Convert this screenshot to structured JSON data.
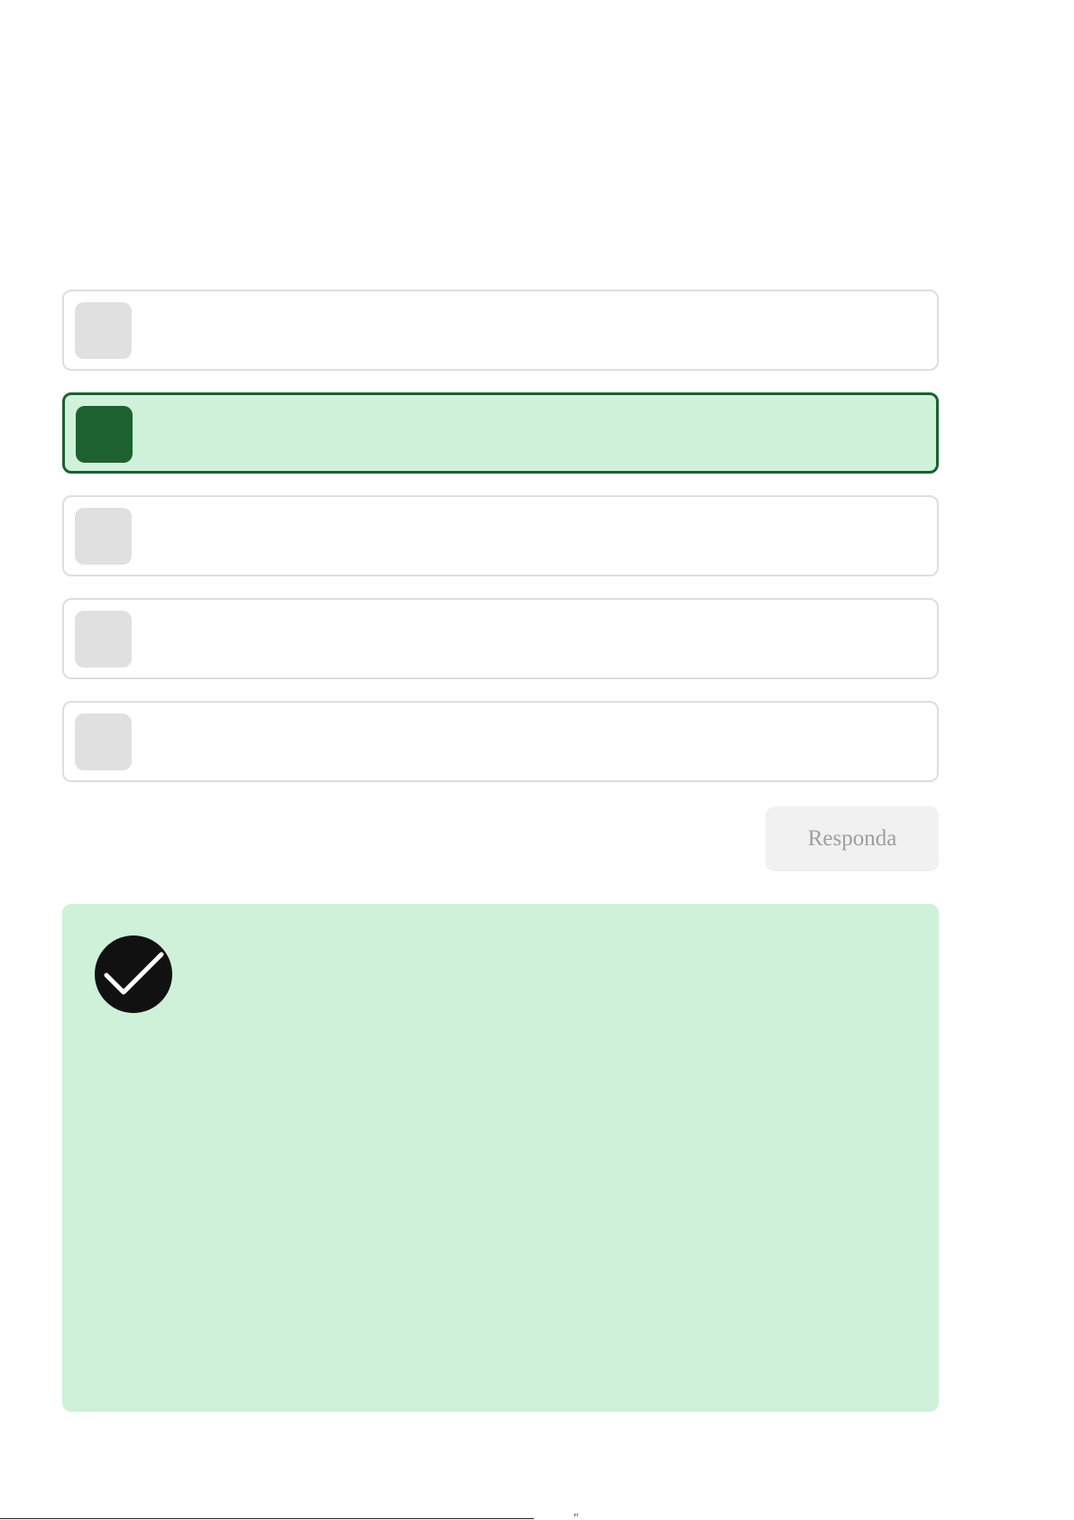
{
  "quiz": {
    "options": [
      {
        "label": "",
        "selected": false
      },
      {
        "label": "",
        "selected": true
      },
      {
        "label": "",
        "selected": false
      },
      {
        "label": "",
        "selected": false
      },
      {
        "label": "",
        "selected": false
      }
    ],
    "submit_label": "Responda"
  },
  "feedback": {
    "status": "correct",
    "icon": "check-circle-icon",
    "text": ""
  },
  "footer": {
    "mark": "\""
  },
  "colors": {
    "selected_border": "#1c6130",
    "selected_fill": "#d0f1da",
    "selected_marker": "#1d622e",
    "feedback_fill": "#cff1d9",
    "icon_fill": "#111111"
  }
}
